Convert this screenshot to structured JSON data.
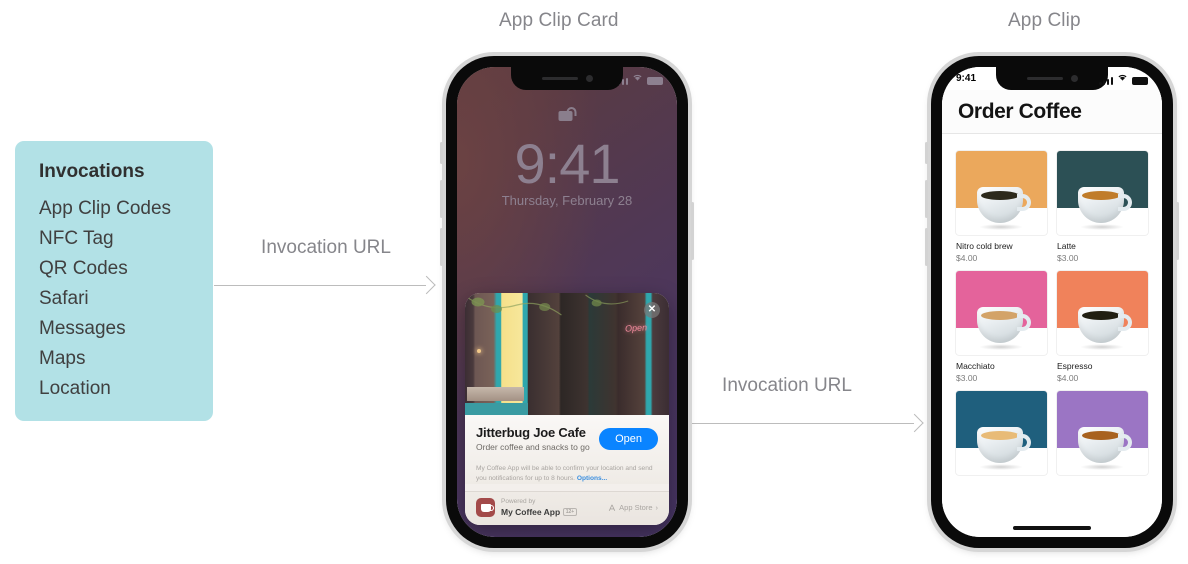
{
  "headings": {
    "card": "App Clip Card",
    "clip": "App Clip"
  },
  "panel": {
    "title": "Invocations",
    "items": [
      "App Clip Codes",
      "NFC Tag",
      "QR Codes",
      "Safari",
      "Messages",
      "Maps",
      "Location"
    ],
    "background_color": "#b2e1e6"
  },
  "arrows": [
    {
      "label": "Invocation URL"
    },
    {
      "label": "Invocation URL"
    }
  ],
  "lock_screen": {
    "time": "9:41",
    "date": "Thursday, February 28",
    "lock_icon": "unlocked-lock-icon",
    "status": {
      "signal_icon": "cellular-signal-icon",
      "wifi_icon": "wifi-icon",
      "battery_icon": "battery-icon"
    }
  },
  "app_clip_card": {
    "close_icon": "close-icon",
    "photo_alt_text": "Open",
    "title": "Jitterbug Joe Cafe",
    "subtitle": "Order coffee and snacks to go",
    "open_button": "Open",
    "open_button_color": "#0a84ff",
    "notice": "My Coffee App will be able to confirm your location and send you notifications for up to 8 hours.",
    "notice_link": "Options...",
    "powered_by_label": "Powered by",
    "app_name": "My Coffee App",
    "age_rating": "12+",
    "app_store_label": "App Store",
    "app_icon": "coffee-mug-icon",
    "chevron_icon": "chevron-right-icon",
    "appstore_icon": "app-store-icon"
  },
  "app_clip_app": {
    "status": {
      "time": "9:41",
      "signal_icon": "cellular-signal-icon",
      "wifi_icon": "wifi-icon",
      "battery_icon": "battery-icon"
    },
    "title": "Order Coffee",
    "items": [
      {
        "name": "Nitro cold brew",
        "price": "$4.00",
        "swatch": "#eba85c",
        "liquid": "#2d2a1c"
      },
      {
        "name": "Latte",
        "price": "$3.00",
        "swatch": "#2c5055",
        "liquid": "#c07c2a"
      },
      {
        "name": "Macchiato",
        "price": "$3.00",
        "swatch": "#e4639b",
        "liquid": "#d3a368"
      },
      {
        "name": "Espresso",
        "price": "$4.00",
        "swatch": "#f0825b",
        "liquid": "#211f12"
      },
      {
        "name": "",
        "price": "",
        "swatch": "#1f5f7d",
        "liquid": "#e8bb77"
      },
      {
        "name": "",
        "price": "",
        "swatch": "#9b75c4",
        "liquid": "#a8621f"
      }
    ]
  }
}
